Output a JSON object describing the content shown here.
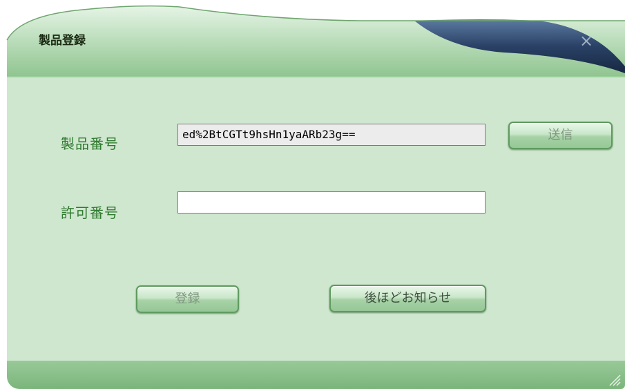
{
  "window": {
    "title": "製品登録",
    "close_symbol": "×",
    "icons": {
      "close": "close-icon",
      "resize": "resize-grip-icon"
    },
    "colors": {
      "panel": "#cfe7cf",
      "header": "#a8d3a8",
      "accent": "#263b59",
      "label": "#2f7a2f"
    }
  },
  "form": {
    "product_number_label": "製品番号",
    "product_number_value": "ed%2BtCGTt9hsHn1yaARb23g==",
    "license_number_label": "許可番号",
    "license_number_value": ""
  },
  "buttons": {
    "send_label": "送信",
    "register_label": "登録",
    "later_label": "後ほどお知らせ"
  }
}
